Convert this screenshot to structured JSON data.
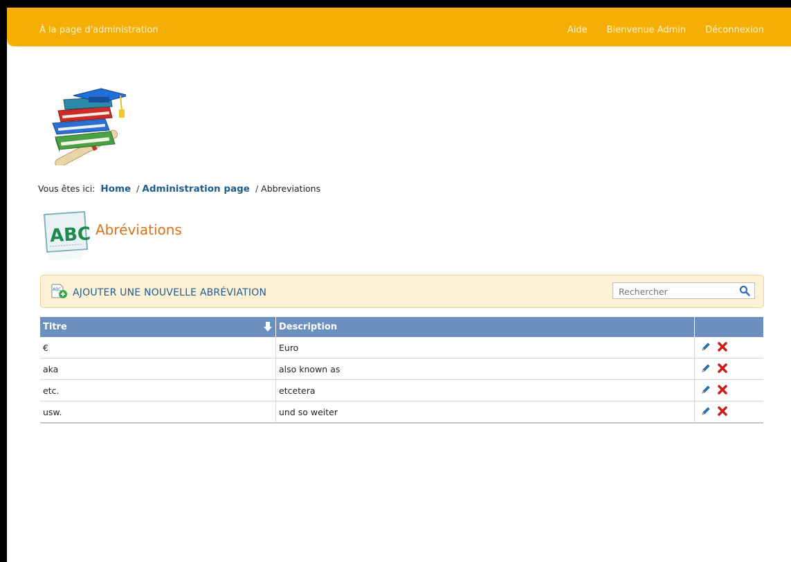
{
  "header": {
    "admin_link": "À la page d'administration",
    "help": "Aide",
    "welcome": "Bienvenue Admin",
    "logout": "Déconnexion"
  },
  "breadcrumb": {
    "prefix": "Vous êtes ici:",
    "items": [
      "Home",
      "Administration page"
    ],
    "current": "Abbreviations"
  },
  "page": {
    "title": "Abréviations"
  },
  "toolbar": {
    "add_label": "AJOUTER UNE NOUVELLE ABRÉVIATION",
    "search_placeholder": "Rechercher"
  },
  "table": {
    "columns": [
      "Titre",
      "Description",
      ""
    ],
    "rows": [
      {
        "title": "€",
        "description": "Euro"
      },
      {
        "title": "aka",
        "description": "also known as"
      },
      {
        "title": "etc.",
        "description": "etcetera"
      },
      {
        "title": "usw.",
        "description": "und so weiter"
      }
    ]
  },
  "icons": {
    "logo": "books-graduation-cap-icon",
    "section": "abc-board-icon",
    "add": "add-document-icon",
    "search": "search-icon",
    "sort": "sort-down-arrow-icon",
    "edit": "pencil-icon",
    "delete": "red-x-icon"
  },
  "colors": {
    "topbar": "#f5ae05",
    "link": "#1f5c8a",
    "title": "#d9731a",
    "table_header": "#6b8fbf",
    "toolbar_bg": "#fdf1d6"
  }
}
